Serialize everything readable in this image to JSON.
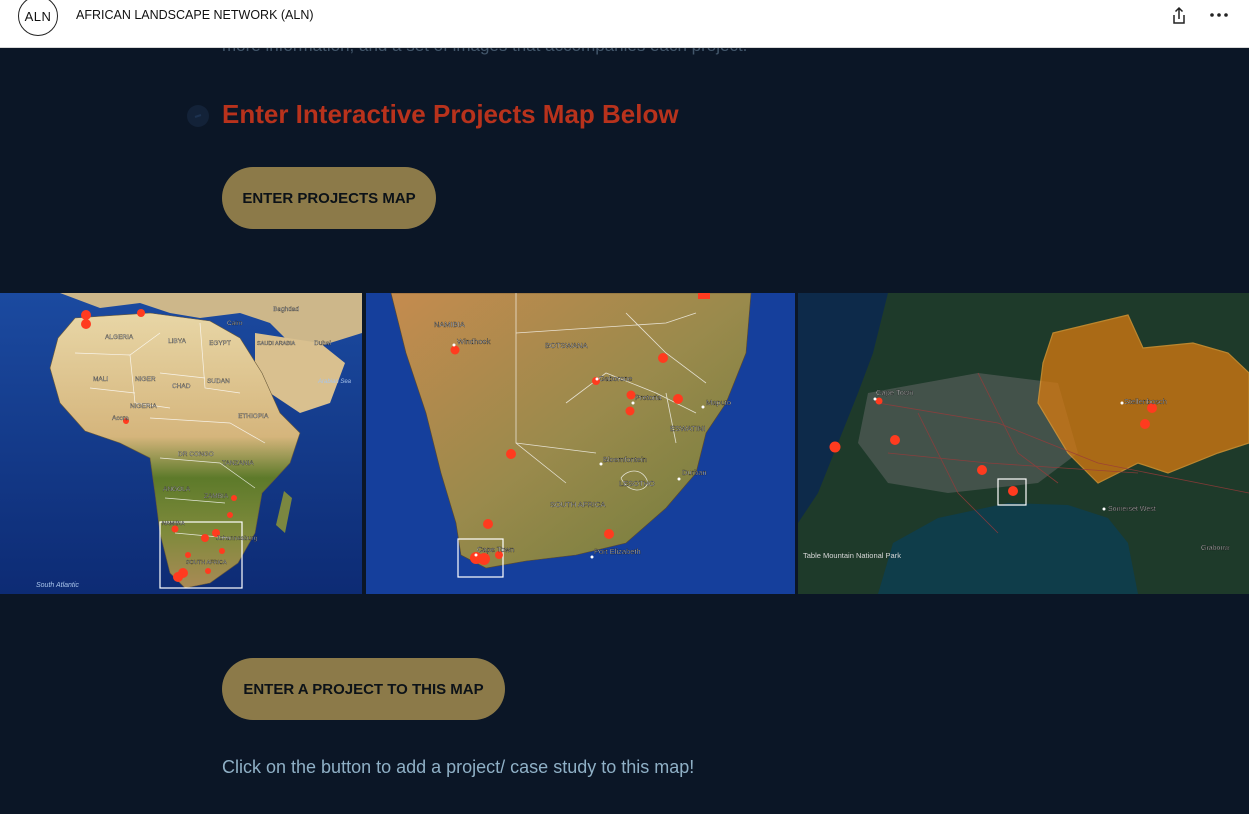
{
  "header": {
    "logo_text": "ALN",
    "site_title": "AFRICAN LANDSCAPE NETWORK (ALN)",
    "share_icon": "share-icon",
    "more_icon": "more-options-icon"
  },
  "intro": {
    "partial_text": "more information, and a set of images that accompanies each project."
  },
  "section": {
    "heading": "Enter Interactive Projects Map Below",
    "heading_color": "#b8321c"
  },
  "buttons": {
    "projects_map": "ENTER PROJECTS MAP",
    "enter_project": "ENTER A PROJECT TO THIS MAP",
    "button_color": "#8c7a49"
  },
  "maps": {
    "africa": {
      "labels": [
        "Baghdad",
        "Cairo",
        "Dubai",
        "ALGERIA",
        "LIBYA",
        "EGYPT",
        "SAUDI ARABIA",
        "MALI",
        "NIGER",
        "CHAD",
        "SUDAN",
        "Arabian Sea",
        "NIGERIA",
        "Accra",
        "ETHIOPIA",
        "DR CONGO",
        "TANZANIA",
        "ANGOLA",
        "ZAMBIA",
        "NAMIBIA",
        "Johannesburg",
        "SOUTH AFRICA",
        "South Atlantic"
      ]
    },
    "southern_africa": {
      "labels": [
        "NAMIBIA",
        "Windhoek",
        "BOTSWANA",
        "Gaborone",
        "Pretoria",
        "Maputo",
        "ESWATINI",
        "Bloemfontein",
        "LESOTHO",
        "Durban",
        "SOUTH AFRICA",
        "Cape Town",
        "Port Elizabeth"
      ]
    },
    "cape_town": {
      "labels": [
        "Cape Town",
        "Stellenbosch",
        "Somerset West",
        "Table Mountain National Park",
        "Grabouw"
      ]
    },
    "marker_color": "#ff3b1f"
  },
  "footer": {
    "helper_text": "Click on the button to add a project/ case study to this map!"
  }
}
